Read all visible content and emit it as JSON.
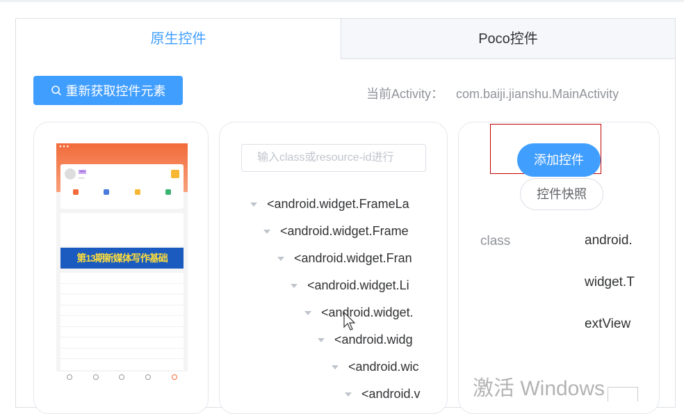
{
  "tabs": [
    {
      "label": "原生控件",
      "active": true
    },
    {
      "label": "Poco控件",
      "active": false
    }
  ],
  "toolbar": {
    "refresh_label": "重新获取控件元素",
    "activity_label": "当前Activity：",
    "activity_value": "com.baiji.jianshu.MainActivity"
  },
  "phone_preview": {
    "banner_text": "第13期新媒体写作基础"
  },
  "tree": {
    "search_placeholder": "输入class或resource-id进行",
    "nodes": [
      "<android.widget.FrameLa",
      "<android.widget.Frame",
      "<android.widget.Fran",
      "<android.widget.Li",
      "<android.widget.",
      "<android.widg",
      "<android.wic",
      "<android.v"
    ]
  },
  "detail": {
    "add_label": "添加控件",
    "snapshot_label": "控件快照",
    "attr_key": "class",
    "attr_value": "android.widget.TextView"
  },
  "watermark": "激活 Windows",
  "colors": {
    "accent": "#409eff",
    "highlight_box": "#c00000"
  }
}
